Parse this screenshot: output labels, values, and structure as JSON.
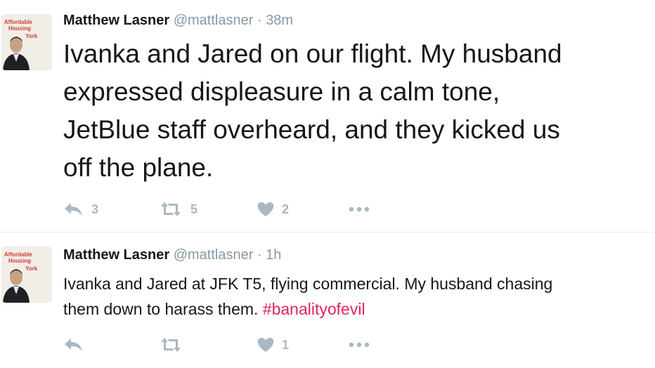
{
  "tweets": [
    {
      "name": "Matthew Lasner",
      "handle": "@mattlasner",
      "separator": "·",
      "time": "38m",
      "text_lines": [
        "Ivanka and Jared on our flight. My husband",
        "expressed displeasure in a calm tone,",
        "JetBlue staff overheard, and they kicked us",
        "off the plane."
      ],
      "replies": "3",
      "retweets": "5",
      "likes": "2",
      "avatar_text": [
        "Affordable",
        "Housing",
        "York"
      ]
    },
    {
      "name": "Matthew Lasner",
      "handle": "@mattlasner",
      "separator": "·",
      "time": "1h",
      "text_line1": "Ivanka and Jared at JFK T5, flying commercial. My husband chasing",
      "text_line2": "them down to harass them. ",
      "hashtag": "#banalityofevil",
      "likes": "1",
      "avatar_text": [
        "Affordable",
        "Housing",
        "York"
      ]
    }
  ],
  "icons": {
    "reply": "reply-icon",
    "retweet": "retweet-icon",
    "like": "heart-icon",
    "more": "more-icon"
  },
  "colors": {
    "text": "#14171a",
    "muted": "#8899a6",
    "icon": "#aab8c2",
    "hashtag": "#e0245e",
    "divider": "#e6ecf0"
  }
}
